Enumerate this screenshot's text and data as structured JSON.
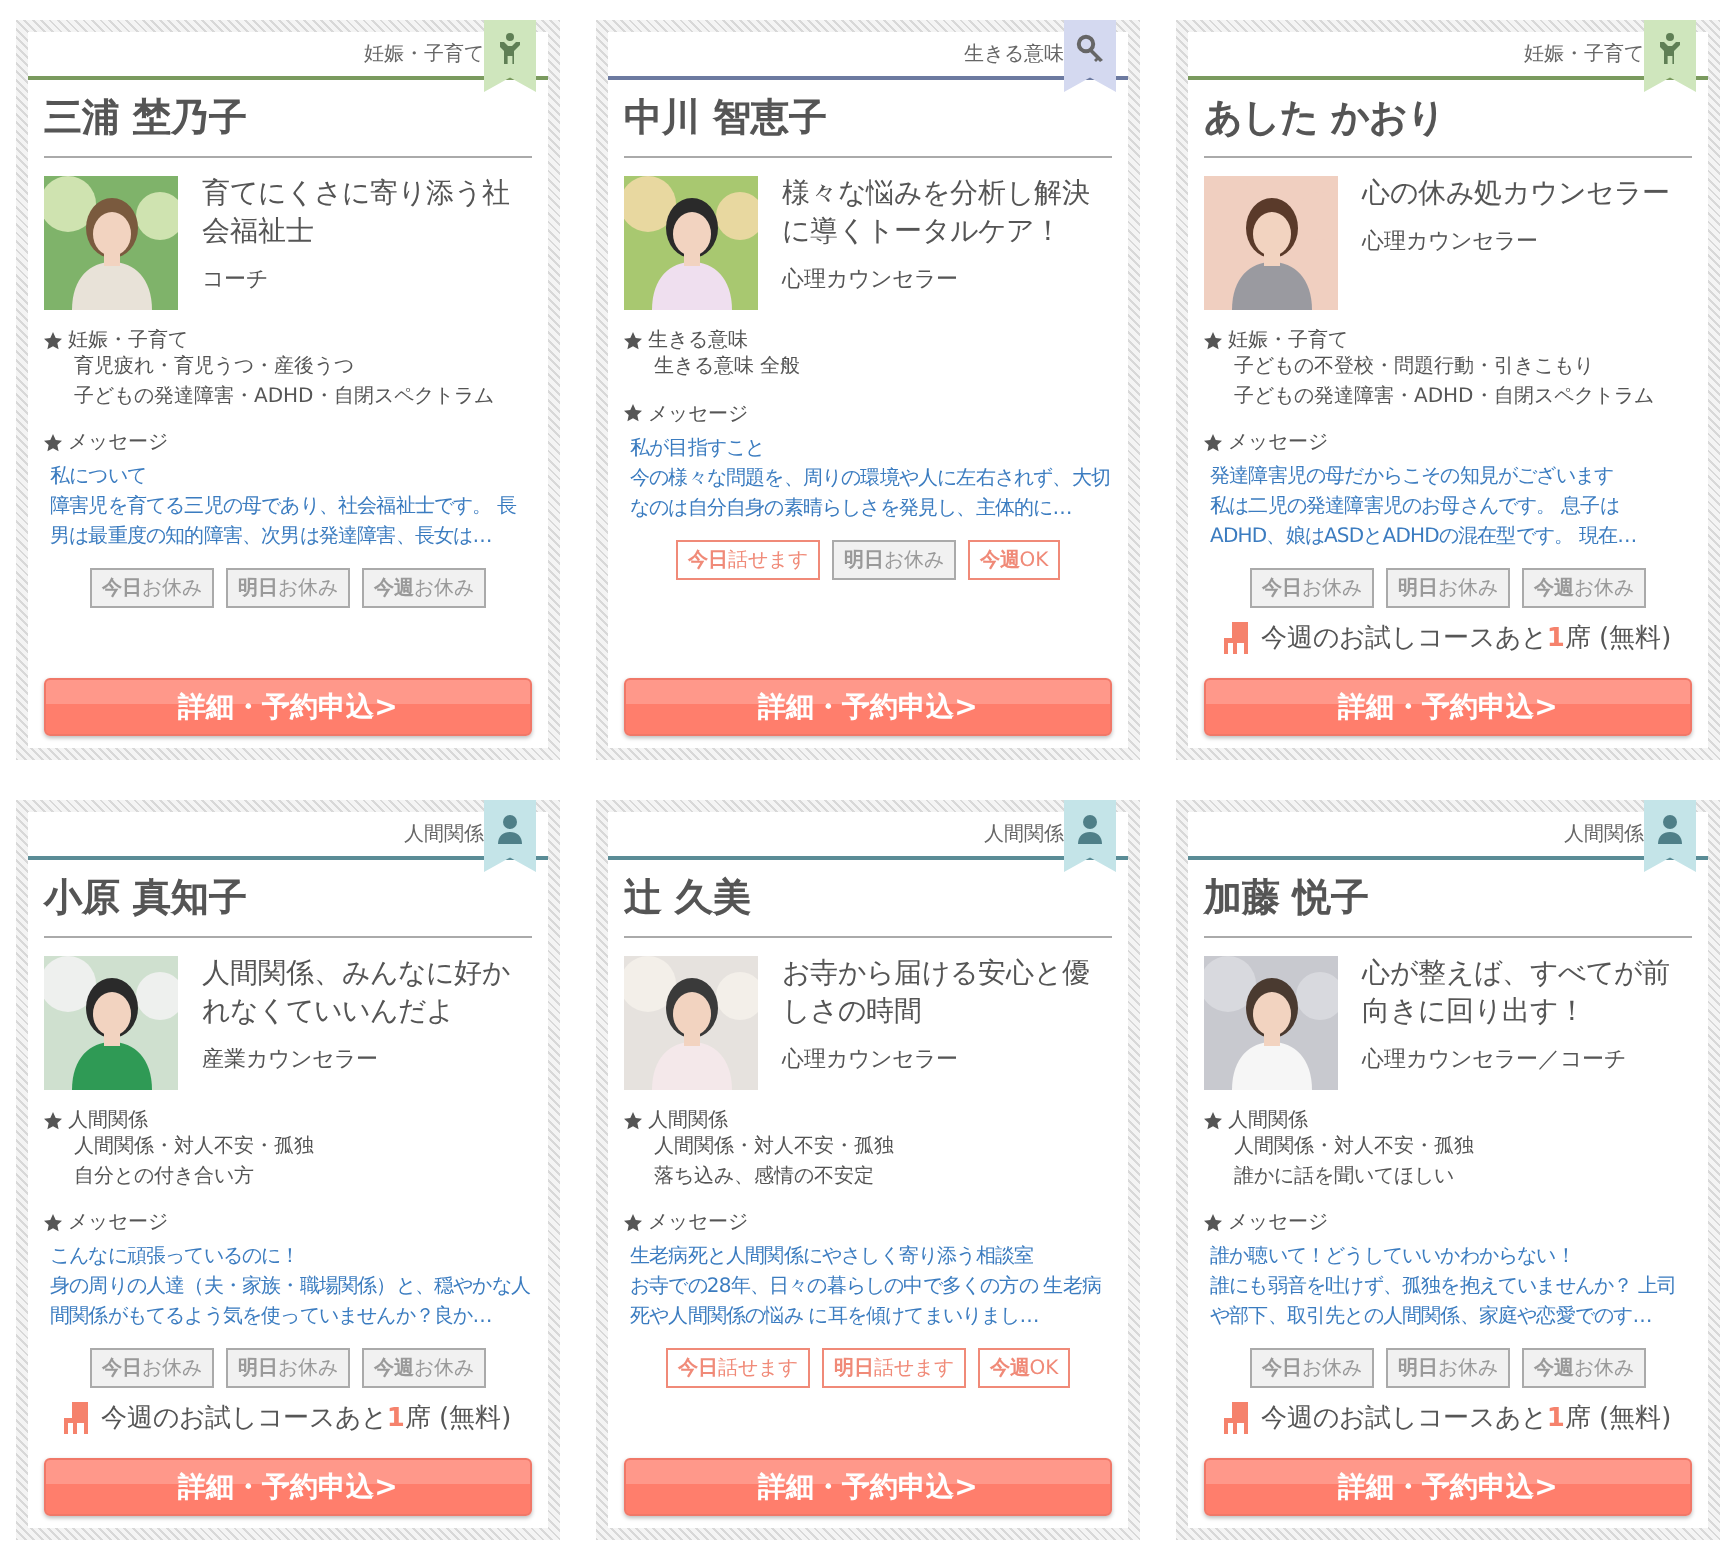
{
  "cards": [
    {
      "category": {
        "label": "妊娠・子育て",
        "kind": "parenting"
      },
      "name": "三浦 埜乃子",
      "catchphrase": "育てにくさに寄り添う社会福祉士",
      "role": "コーチ",
      "topic": {
        "label": "妊娠・子育て",
        "items": [
          "育児疲れ・育児うつ・産後うつ",
          "子どもの発達障害・ADHD・自閉スペクトラム"
        ]
      },
      "message": {
        "label": "メッセージ",
        "title": "私について",
        "body": "障害児を育てる三児の母であり、社会福祉士です。 長男は最重度の知的障害、次男は発達障害、長女は…"
      },
      "availability": [
        {
          "text": "**今日**お休み",
          "available": false
        },
        {
          "text": "**明日**お休み",
          "available": false
        },
        {
          "text": "**今週**お休み",
          "available": false
        }
      ],
      "button": "詳細・予約申込>"
    },
    {
      "category": {
        "label": "生きる意味",
        "kind": "meaning"
      },
      "name": "中川 智恵子",
      "catchphrase": "様々な悩みを分析し解決に導くトータルケア！",
      "role": "心理カウンセラー",
      "topic": {
        "label": "生きる意味",
        "items": [
          "生きる意味 全般"
        ]
      },
      "message": {
        "label": "メッセージ",
        "title": "私が目指すこと",
        "body": "今の様々な問題を、周りの環境や人に左右されず、大切なのは自分自身の素晴らしさを発見し、主体的に…"
      },
      "availability": [
        {
          "text": "**今日**話せます",
          "available": true
        },
        {
          "text": "**明日**お休み",
          "available": false
        },
        {
          "text": "**今週**OK",
          "available": true
        }
      ],
      "button": "詳細・予約申込>"
    },
    {
      "category": {
        "label": "妊娠・子育て",
        "kind": "parenting"
      },
      "name": "あした かおり",
      "catchphrase": "心の休み処カウンセラー",
      "role": "心理カウンセラー",
      "topic": {
        "label": "妊娠・子育て",
        "items": [
          "子どもの不登校・問題行動・引きこもり",
          "子どもの発達障害・ADHD・自閉スペクトラム"
        ]
      },
      "message": {
        "label": "メッセージ",
        "title": "発達障害児の母だからこその知見がございます",
        "body": "私は二児の発達障害児のお母さんです。 息子はADHD、娘はASDとADHDの混在型です。 現在…"
      },
      "availability": [
        {
          "text": "**今日**お休み",
          "available": false
        },
        {
          "text": "**明日**お休み",
          "available": false
        },
        {
          "text": "**今週**お休み",
          "available": false
        }
      ],
      "trial": "今週のお試しコースあと**1**席 (無料)",
      "button": "詳細・予約申込>"
    },
    {
      "category": {
        "label": "人間関係",
        "kind": "relations"
      },
      "name": "小原 真知子",
      "catchphrase": "人間関係、みんなに好かれなくていいんだよ",
      "role": "産業カウンセラー",
      "topic": {
        "label": "人間関係",
        "items": [
          "人間関係・対人不安・孤独",
          "自分との付き合い方"
        ]
      },
      "message": {
        "label": "メッセージ",
        "title": "こんなに頑張っているのに！",
        "body": "身の周りの人達（夫・家族・職場関係）と、穏やかな人間関係がもてるよう気を使っていませんか？良か…"
      },
      "availability": [
        {
          "text": "**今日**お休み",
          "available": false
        },
        {
          "text": "**明日**お休み",
          "available": false
        },
        {
          "text": "**今週**お休み",
          "available": false
        }
      ],
      "trial": "今週のお試しコースあと**1**席 (無料)",
      "button": "詳細・予約申込>"
    },
    {
      "category": {
        "label": "人間関係",
        "kind": "relations"
      },
      "name": "辻 久美",
      "catchphrase": "お寺から届ける安心と優しさの時間",
      "role": "心理カウンセラー",
      "topic": {
        "label": "人間関係",
        "items": [
          "人間関係・対人不安・孤独",
          "落ち込み、感情の不安定"
        ]
      },
      "message": {
        "label": "メッセージ",
        "title": "生老病死と人間関係にやさしく寄り添う相談室",
        "body": "お寺での28年、日々の暮らしの中で多くの方の 生老病死や人間関係の悩み に耳を傾けてまいりまし…"
      },
      "availability": [
        {
          "text": "**今日**話せます",
          "available": true
        },
        {
          "text": "**明日**話せます",
          "available": true
        },
        {
          "text": "**今週**OK",
          "available": true
        }
      ],
      "button": "詳細・予約申込>"
    },
    {
      "category": {
        "label": "人間関係",
        "kind": "relations"
      },
      "name": "加藤 悦子",
      "catchphrase": "心が整えば、すべてが前向きに回り出す！",
      "role": "心理カウンセラー／コーチ",
      "topic": {
        "label": "人間関係",
        "items": [
          "人間関係・対人不安・孤独",
          "誰かに話を聞いてほしい"
        ]
      },
      "message": {
        "label": "メッセージ",
        "title": "誰か聴いて！どうしていいかわからない！",
        "body": "誰にも弱音を吐けず、孤独を抱えていませんか？ 上司や部下、取引先との人間関係、家庭や恋愛でのす…"
      },
      "availability": [
        {
          "text": "**今日**お休み",
          "available": false
        },
        {
          "text": "**明日**お休み",
          "available": false
        },
        {
          "text": "**今週**お休み",
          "available": false
        }
      ],
      "trial": "今週のお試しコースあと**1**席 (無料)",
      "button": "詳細・予約申込>"
    }
  ]
}
